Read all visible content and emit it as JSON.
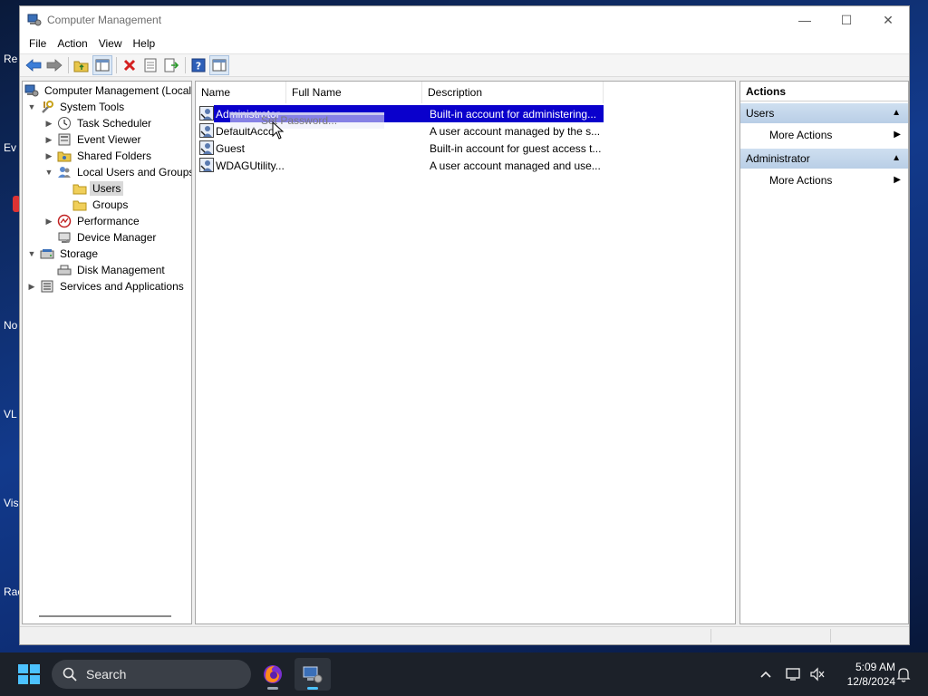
{
  "window": {
    "title": "Computer Management",
    "controls": {
      "minimize": "—",
      "maximize": "☐",
      "close": "✕"
    }
  },
  "menu": [
    "File",
    "Action",
    "View",
    "Help"
  ],
  "toolbar_icons": [
    "back-arrow-icon",
    "forward-arrow-icon",
    "up-folder-icon",
    "show-hide-tree-icon",
    "delete-icon",
    "properties-icon",
    "export-list-icon",
    "help-icon",
    "show-action-pane-icon"
  ],
  "tree": {
    "root": "Computer Management (Local",
    "system_tools": "System Tools",
    "task_scheduler": "Task Scheduler",
    "event_viewer": "Event Viewer",
    "shared_folders": "Shared Folders",
    "local_users_groups": "Local Users and Groups",
    "users": "Users",
    "groups": "Groups",
    "performance": "Performance",
    "device_manager": "Device Manager",
    "storage": "Storage",
    "disk_management": "Disk Management",
    "services_apps": "Services and Applications"
  },
  "list": {
    "columns": {
      "name": "Name",
      "full_name": "Full Name",
      "description": "Description"
    },
    "rows": [
      {
        "name": "Administrator",
        "full_name": "",
        "description": "Built-in account for administering..."
      },
      {
        "name": "DefaultAcco",
        "full_name": "",
        "description": "A user account managed by the s..."
      },
      {
        "name": "Guest",
        "full_name": "",
        "description": "Built-in account for guest access t..."
      },
      {
        "name": "WDAGUtility...",
        "full_name": "",
        "description": "A user account managed and use..."
      }
    ],
    "drag_ghost": "Set Password..."
  },
  "actions": {
    "title": "Actions",
    "section1": "Users",
    "section1_item": "More Actions",
    "section2": "Administrator",
    "section2_item": "More Actions"
  },
  "desktop_labels": [
    "Re",
    "Ev",
    "No",
    "VL",
    "Vis",
    "Rac"
  ],
  "taskbar": {
    "search": "Search",
    "time": "5:09 AM",
    "date": "12/8/2024"
  },
  "colors": {
    "selection": "#0a00cc",
    "accent": "#1c2129"
  }
}
